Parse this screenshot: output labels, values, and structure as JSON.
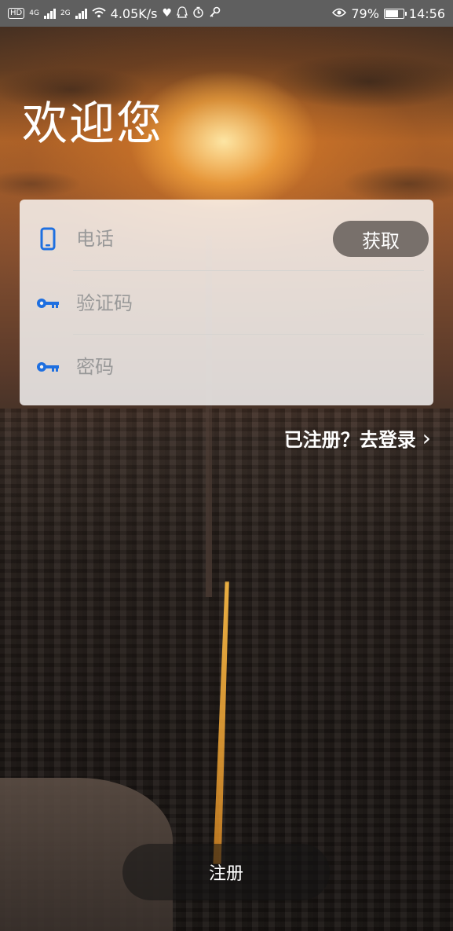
{
  "status_bar": {
    "hd": "HD",
    "net1": "4G",
    "net2": "2G",
    "speed": "4.05K/s",
    "battery_percent": "79%",
    "battery_level": 0.79,
    "time": "14:56"
  },
  "title": "欢迎您",
  "form": {
    "phone_placeholder": "电话",
    "get_code_label": "获取",
    "code_placeholder": "验证码",
    "password_placeholder": "密码"
  },
  "login_link": {
    "label": "已注册？去登录",
    "chevron": "›"
  },
  "register_label": "注册",
  "colors": {
    "icon_blue": "#1e6fe0",
    "card_bg": "rgba(255,255,255,0.80)"
  },
  "icons": [
    "phone-icon",
    "key-icon",
    "key-icon"
  ]
}
